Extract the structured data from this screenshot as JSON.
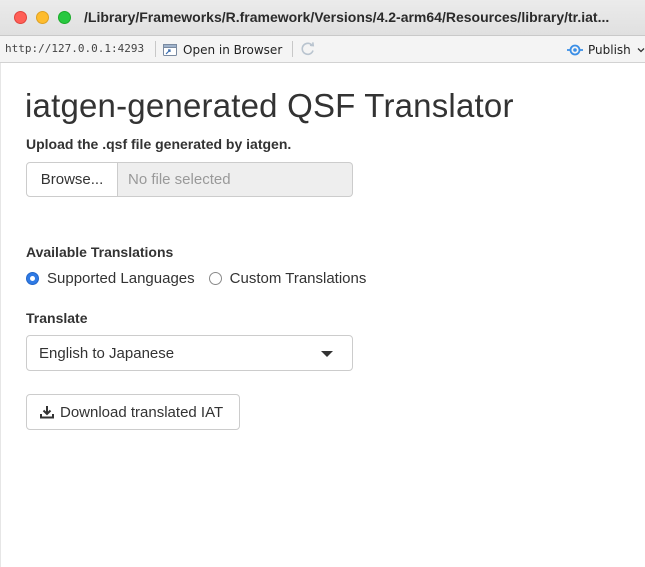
{
  "window": {
    "title": "/Library/Frameworks/R.framework/Versions/4.2-arm64/Resources/library/tr.iat..."
  },
  "toolbar": {
    "url": "http://127.0.0.1:4293",
    "open_in_browser_label": "Open in Browser",
    "publish_label": "Publish"
  },
  "app": {
    "title": "iatgen-generated QSF Translator",
    "upload": {
      "label": "Upload the .qsf file generated by iatgen.",
      "browse_label": "Browse...",
      "file_placeholder": "No file selected"
    },
    "translations": {
      "label": "Available Translations",
      "options": [
        {
          "label": "Supported Languages",
          "selected": true
        },
        {
          "label": "Custom Translations",
          "selected": false
        }
      ]
    },
    "translate": {
      "label": "Translate",
      "selected_value": "English to Japanese"
    },
    "download_label": "Download translated IAT"
  },
  "colors": {
    "accent": "#2f7ae5",
    "input_disabled_bg": "#eeeeee",
    "text": "#333333"
  },
  "icons": {
    "open_in_browser": "open-in-browser-icon",
    "refresh": "refresh-icon",
    "publish": "publish-icon",
    "download": "download-icon",
    "dropdown": "caret-down-icon"
  }
}
